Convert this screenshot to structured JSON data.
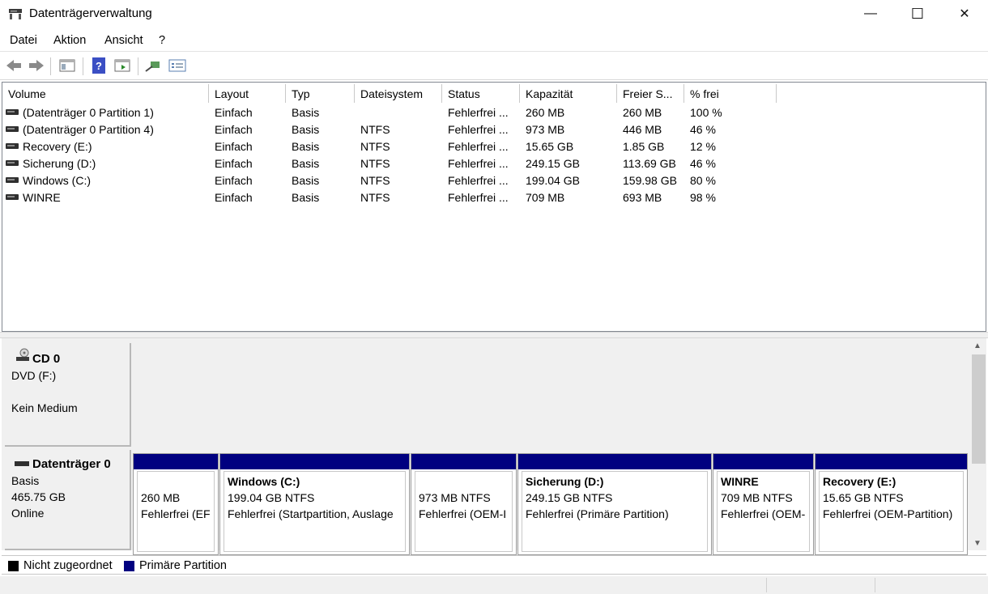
{
  "window": {
    "title": "Datenträgerverwaltung",
    "minimize_glyph": "—",
    "maximize_glyph": "☐",
    "close_glyph": "✕"
  },
  "menu": {
    "items": [
      "Datei",
      "Aktion",
      "Ansicht",
      "?"
    ]
  },
  "toolbar": {
    "icons": [
      "back-arrow-icon",
      "forward-arrow-icon",
      "console-tree-icon",
      "help-icon",
      "action-pane-icon",
      "connect-icon",
      "properties-icon"
    ]
  },
  "volume_list": {
    "columns": [
      "Volume",
      "Layout",
      "Typ",
      "Dateisystem",
      "Status",
      "Kapazität",
      "Freier S...",
      "% frei"
    ],
    "rows": [
      {
        "volume": "(Datenträger 0 Partition 1)",
        "layout": "Einfach",
        "typ": "Basis",
        "dateisystem": "",
        "status": "Fehlerfrei ...",
        "kapazitaet": "260 MB",
        "frei": "260 MB",
        "prozent": "100 %"
      },
      {
        "volume": "(Datenträger 0 Partition 4)",
        "layout": "Einfach",
        "typ": "Basis",
        "dateisystem": "NTFS",
        "status": "Fehlerfrei ...",
        "kapazitaet": "973 MB",
        "frei": "446 MB",
        "prozent": "46 %"
      },
      {
        "volume": "Recovery (E:)",
        "layout": "Einfach",
        "typ": "Basis",
        "dateisystem": "NTFS",
        "status": "Fehlerfrei ...",
        "kapazitaet": "15.65 GB",
        "frei": "1.85 GB",
        "prozent": "12 %"
      },
      {
        "volume": "Sicherung (D:)",
        "layout": "Einfach",
        "typ": "Basis",
        "dateisystem": "NTFS",
        "status": "Fehlerfrei ...",
        "kapazitaet": "249.15 GB",
        "frei": "113.69 GB",
        "prozent": "46 %"
      },
      {
        "volume": "Windows (C:)",
        "layout": "Einfach",
        "typ": "Basis",
        "dateisystem": "NTFS",
        "status": "Fehlerfrei ...",
        "kapazitaet": "199.04 GB",
        "frei": "159.98 GB",
        "prozent": "80 %"
      },
      {
        "volume": "WINRE",
        "layout": "Einfach",
        "typ": "Basis",
        "dateisystem": "NTFS",
        "status": "Fehlerfrei ...",
        "kapazitaet": "709 MB",
        "frei": "693 MB",
        "prozent": "98 %"
      }
    ]
  },
  "cd0": {
    "name": "CD 0",
    "drive": "DVD (F:)",
    "media": "Kein Medium"
  },
  "disk0": {
    "name": "Datenträger 0",
    "type": "Basis",
    "size": "465.75 GB",
    "state": "Online",
    "partitions": [
      {
        "title": "",
        "size": "260 MB",
        "status": "Fehlerfrei (EF"
      },
      {
        "title": "Windows  (C:)",
        "size": "199.04 GB NTFS",
        "status": "Fehlerfrei (Startpartition, Auslage"
      },
      {
        "title": "",
        "size": "973 MB NTFS",
        "status": "Fehlerfrei (OEM-I"
      },
      {
        "title": "Sicherung  (D:)",
        "size": "249.15 GB NTFS",
        "status": "Fehlerfrei (Primäre Partition)"
      },
      {
        "title": "WINRE",
        "size": "709 MB NTFS",
        "status": "Fehlerfrei (OEM-"
      },
      {
        "title": "Recovery  (E:)",
        "size": "15.65 GB NTFS",
        "status": "Fehlerfrei (OEM-Partition)"
      }
    ]
  },
  "legend": {
    "unallocated": "Nicht zugeordnet",
    "primary": "Primäre Partition",
    "unallocated_color": "#000000",
    "primary_color": "#000080"
  }
}
